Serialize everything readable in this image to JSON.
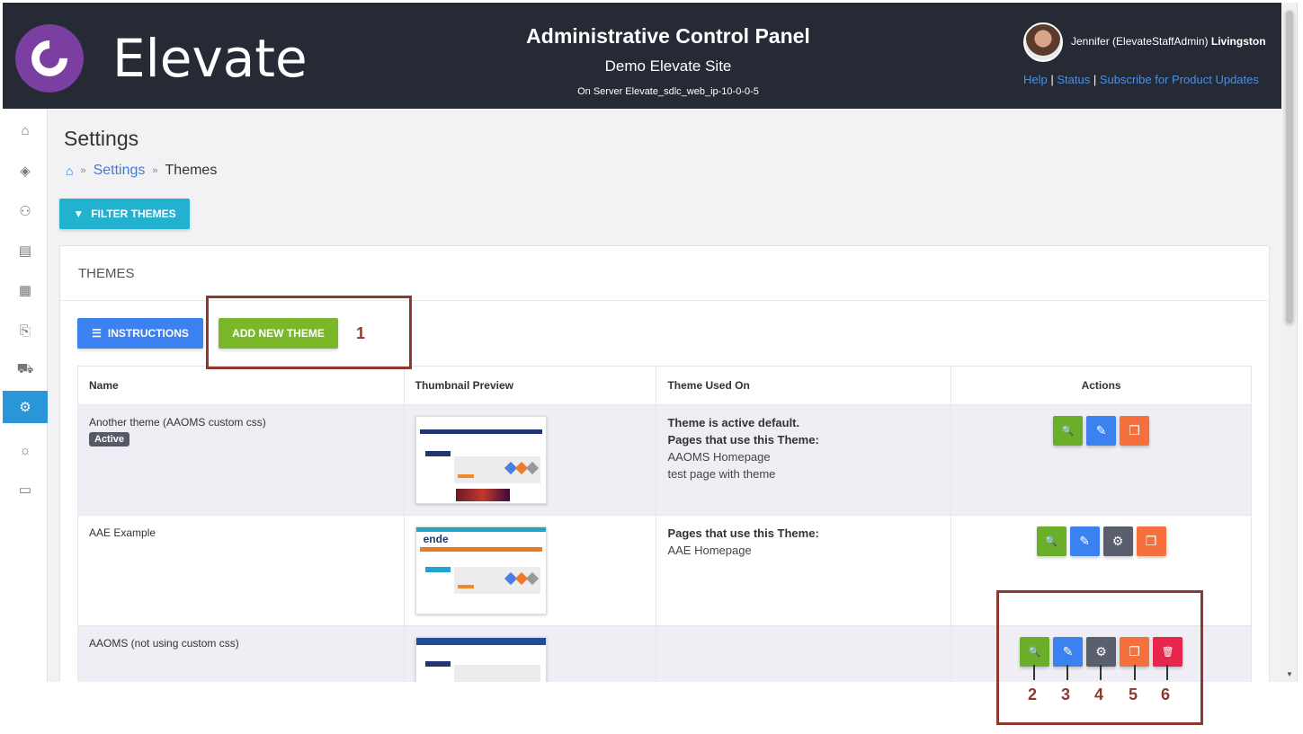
{
  "header": {
    "brand": "Elevate",
    "panel_title": "Administrative Control Panel",
    "site_name": "Demo Elevate Site",
    "server": "On Server Elevate_sdlc_web_ip-10-0-0-5",
    "user_first": "Jennifer (ElevateStaffAdmin)",
    "user_last": "Livingston",
    "links": {
      "help": "Help",
      "sep1": " | ",
      "status": "Status",
      "sep2": " | ",
      "subscribe": "Subscribe for Product Updates"
    }
  },
  "sidebar": {
    "items": [
      {
        "icon": "home-icon",
        "glyph": "⌂"
      },
      {
        "icon": "layers-icon",
        "glyph": "◈"
      },
      {
        "icon": "users-icon",
        "glyph": "⚇"
      },
      {
        "icon": "book-icon",
        "glyph": "▤"
      },
      {
        "icon": "grid-icon",
        "glyph": "▦"
      },
      {
        "icon": "clipboard-icon",
        "glyph": "⎘"
      },
      {
        "icon": "cart-icon",
        "glyph": "⛟"
      },
      {
        "icon": "gear-icon",
        "glyph": "⚙",
        "active": true
      },
      {
        "icon": "lightbulb-icon",
        "glyph": "☼"
      },
      {
        "icon": "monitor-icon",
        "glyph": "▭"
      }
    ]
  },
  "page": {
    "title": "Settings",
    "breadcrumb": {
      "settings": "Settings",
      "sep": "»",
      "current": "Themes"
    },
    "filter_label": "FILTER THEMES"
  },
  "card": {
    "title": "THEMES",
    "instructions_label": "INSTRUCTIONS",
    "add_label": "ADD NEW THEME"
  },
  "table": {
    "headers": [
      "Name",
      "Thumbnail Preview",
      "Theme Used On",
      "Actions"
    ],
    "rows": [
      {
        "name": "Another theme (AAOMS custom css)",
        "badge": "Active",
        "used_default": "Theme is active default.",
        "used_heading": "Pages that use this Theme:",
        "pages": [
          "AAOMS Homepage",
          "test page with theme"
        ]
      },
      {
        "name": "AAE Example",
        "thumb_logo": "ende",
        "used_heading": "Pages that use this Theme:",
        "pages": [
          "AAE Homepage"
        ]
      },
      {
        "name": "AAOMS (not using custom css)"
      }
    ]
  },
  "icons": {
    "view": "🔍",
    "edit": "✎",
    "settings": "⚙",
    "copy": "❐",
    "delete": "🗑",
    "filter": "▼",
    "list": "☰",
    "home": "⌂"
  },
  "annotations": [
    "1",
    "2",
    "3",
    "4",
    "5",
    "6"
  ],
  "colors": {
    "header_bg": "#262a35",
    "accent_blue": "#3b82f0",
    "accent_green": "#7ab82a",
    "accent_teal": "#22b1cf",
    "annotation": "#8b3a30"
  }
}
